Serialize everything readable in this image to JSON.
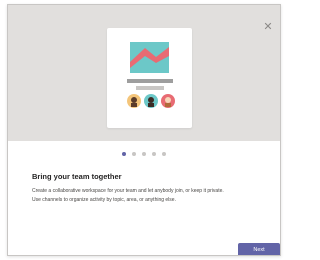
{
  "dialog": {
    "close_icon": "close-icon",
    "title": "Bring your team together",
    "description_line1": "Create a collaborative workspace for your team and let anybody join, or keep it private.",
    "description_line2": "Use channels to organize activity by topic, area, or anything else.",
    "next_label": "Next",
    "carousel": {
      "total": 5,
      "active_index": 0
    }
  },
  "colors": {
    "accent": "#6264a7",
    "hero_background": "#e1dfdd",
    "image_sky": "#6cc8c8",
    "image_mountain": "#e86b73"
  }
}
